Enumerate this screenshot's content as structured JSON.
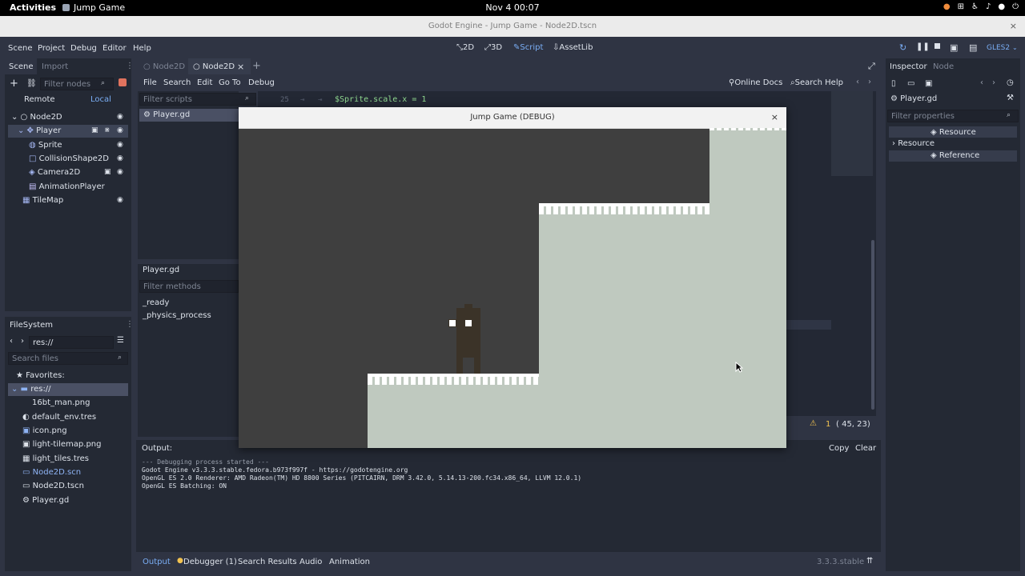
{
  "os": {
    "activities": "Activities",
    "app_name": "Jump Game",
    "clock": "Nov 4  00:07"
  },
  "window": {
    "title": "Godot Engine - Jump Game - Node2D.tscn",
    "close": "×"
  },
  "menu": [
    "Scene",
    "Project",
    "Debug",
    "Editor",
    "Help"
  ],
  "workspaces": [
    {
      "label": "2D"
    },
    {
      "label": "3D"
    },
    {
      "label": "Script",
      "active": true
    },
    {
      "label": "AssetLib"
    }
  ],
  "renderer": "GLES2",
  "scene_dock": {
    "tabs": [
      "Scene",
      "Import"
    ],
    "filter_placeholder": "Filter nodes",
    "remote": "Remote",
    "local": "Local",
    "nodes": [
      {
        "name": "Node2D",
        "depth": 0,
        "color": "#dde2ea",
        "eye": true
      },
      {
        "name": "Player",
        "depth": 1,
        "color": "#a5b7f3",
        "eye": true,
        "selected": true
      },
      {
        "name": "Sprite",
        "depth": 2,
        "color": "#a5b7f3",
        "eye": true
      },
      {
        "name": "CollisionShape2D",
        "depth": 2,
        "color": "#a5b7f3",
        "eye": true
      },
      {
        "name": "Camera2D",
        "depth": 2,
        "color": "#a5b7f3",
        "eye": true
      },
      {
        "name": "AnimationPlayer",
        "depth": 2,
        "color": "#dde2ea",
        "eye": false
      },
      {
        "name": "TileMap",
        "depth": 1,
        "color": "#a5b7f3",
        "eye": true
      }
    ]
  },
  "filesystem": {
    "title": "FileSystem",
    "path": "res://",
    "search_placeholder": "Search files",
    "favorites": "Favorites:",
    "root": "res://",
    "files": [
      {
        "name": "16bt_man.png",
        "color": "#dde2ea"
      },
      {
        "name": "default_env.tres",
        "color": "#dde2ea"
      },
      {
        "name": "icon.png",
        "color": "#dde2ea"
      },
      {
        "name": "light-tilemap.png",
        "color": "#dde2ea"
      },
      {
        "name": "light_tiles.tres",
        "color": "#dde2ea"
      },
      {
        "name": "Node2D.scn",
        "color": "#8fb4f5"
      },
      {
        "name": "Node2D.tscn",
        "color": "#dde2ea"
      },
      {
        "name": "Player.gd",
        "color": "#dde2ea"
      }
    ]
  },
  "script_editor": {
    "tabs": [
      "Node2D",
      "Node2D"
    ],
    "menu": [
      "File",
      "Search",
      "Edit",
      "Go To",
      "Debug"
    ],
    "online_docs": "Online Docs",
    "search_help": "Search Help",
    "filter_scripts_placeholder": "Filter scripts",
    "script_list": [
      "Player.gd"
    ],
    "methods_title": "Player.gd",
    "filter_methods_placeholder": "Filter methods",
    "methods": [
      "_ready",
      "_physics_process"
    ],
    "line_number": "25",
    "code_line": "$Sprite.scale.x = 1",
    "warnings": "1",
    "cursor_pos": "( 45, 23)"
  },
  "output": {
    "title": "Output:",
    "copy": "Copy",
    "clear": "Clear",
    "lines": [
      "--- Debugging process started ---",
      "Godot Engine v3.3.3.stable.fedora.b973f997f - https://godotengine.org",
      "OpenGL ES 2.0 Renderer: AMD Radeon(TM) HD 8800 Series (PITCAIRN, DRM 3.42.0, 5.14.13-200.fc34.x86_64, LLVM 12.0.1)",
      "OpenGL ES Batching: ON"
    ],
    "bottom_tabs": [
      "Output",
      "Debugger (1)",
      "Search Results",
      "Audio",
      "Animation"
    ],
    "version": "3.3.3.stable"
  },
  "inspector": {
    "tabs": [
      "Inspector",
      "Node"
    ],
    "object": "Player.gd",
    "filter_placeholder": "Filter properties",
    "rows": [
      "Resource",
      "Resource",
      "Reference"
    ]
  },
  "game": {
    "title": "Jump Game (DEBUG)",
    "close": "×",
    "colors": {
      "bg": "#3f3f3f",
      "ground": "#bfc9bf",
      "player": "#3b3328"
    }
  }
}
